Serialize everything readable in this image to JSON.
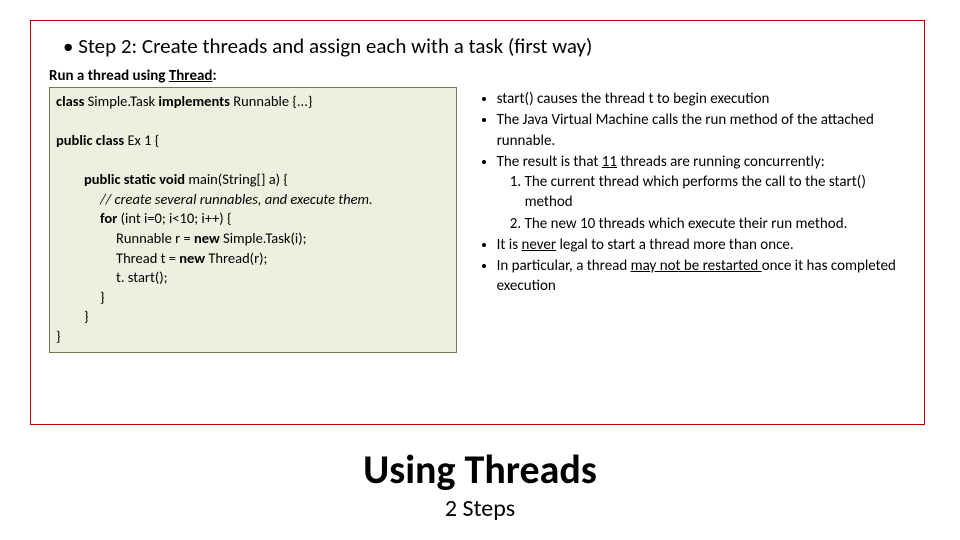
{
  "step_line": "Step 2: Create threads and assign each with a task (first way)",
  "run_prefix": "Run a thread using ",
  "run_thread": "Thread",
  "run_colon": ":",
  "code": {
    "l1a": "class",
    "l1b": " Simple.Task ",
    "l1c": "implements",
    "l1d": " Runnable {...}",
    "l3a": "public class",
    "l3b": " Ex 1 {",
    "l5a": "public static void",
    "l5b": " main(String[] a) {",
    "l6": "// create several runnables, and execute them.",
    "l7a": "for",
    "l7b": " (int i=0; i<10; i++) {",
    "l8a": "Runnable r = ",
    "l8b": "new",
    "l8c": " Simple.Task(i);",
    "l9a": "Thread t = ",
    "l9b": "new",
    "l9c": " Thread(r);",
    "l10": "t. start();",
    "l11": "}",
    "l12": "}",
    "l13": "}"
  },
  "right": {
    "b1": "start() causes the thread t to begin execution",
    "b2": "The Java Virtual Machine calls the run method of the attached runnable.",
    "b3a": "The result is that ",
    "b3b": "11",
    "b3c": " threads are running concurrently:",
    "o1": "The current thread which performs the call to the start() method",
    "o2": "The new 10 threads which execute their run method.",
    "b4a": "It is ",
    "b4b": "never",
    "b4c": " legal to start a thread more than once.",
    "b5a": "In particular, a thread ",
    "b5b": "may not be restarted ",
    "b5c": "once it has completed execution"
  },
  "heading": "Using Threads",
  "subheading": "2 Steps"
}
